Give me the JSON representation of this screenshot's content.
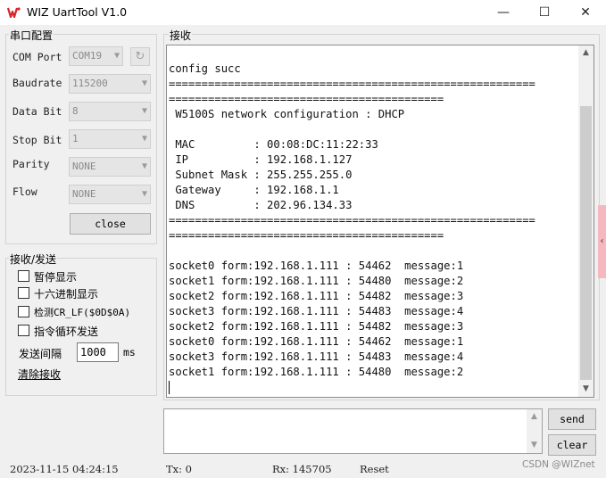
{
  "window": {
    "title": "WIZ UartTool V1.0",
    "controls": {
      "minimize": "—",
      "maximize": "☐",
      "close": "✕"
    }
  },
  "serial_config": {
    "group_label": "串口配置",
    "com_port": {
      "label": "COM Port",
      "value": "COM19"
    },
    "refresh_icon": "↻",
    "baudrate": {
      "label": "Baudrate",
      "value": "115200"
    },
    "data_bit": {
      "label": "Data Bit",
      "value": "8"
    },
    "stop_bit": {
      "label": "Stop Bit",
      "value": "1"
    },
    "parity": {
      "label": "Parity",
      "value": "NONE"
    },
    "flow": {
      "label": "Flow",
      "value": "NONE"
    },
    "close_button": "close"
  },
  "recv_send_options": {
    "group_label": "接收/发送",
    "pause_display": "暂停显示",
    "hex_display": "十六进制显示",
    "detect_crlf": "检测CR_LF($0D$0A)",
    "loop_send": "指令循环发送",
    "send_interval_label": "发送间隔",
    "send_interval_value": "1000",
    "send_interval_unit": "ms",
    "clear_receive_link": "清除接收"
  },
  "receive": {
    "group_label": "接收",
    "lines": [
      "config succ",
      "========================================================",
      "==========================================",
      " W5100S network configuration : DHCP",
      "",
      " MAC         : 00:08:DC:11:22:33",
      " IP          : 192.168.1.127",
      " Subnet Mask : 255.255.255.0",
      " Gateway     : 192.168.1.1",
      " DNS         : 202.96.134.33",
      "========================================================",
      "==========================================",
      "",
      "socket0 form:192.168.1.111 : 54462  message:1",
      "socket1 form:192.168.1.111 : 54480  message:2",
      "socket2 form:192.168.1.111 : 54482  message:3",
      "socket3 form:192.168.1.111 : 54483  message:4",
      "socket2 form:192.168.1.111 : 54482  message:3",
      "socket0 form:192.168.1.111 : 54462  message:1",
      "socket3 form:192.168.1.111 : 54483  message:4",
      "socket1 form:192.168.1.111 : 54480  message:2"
    ]
  },
  "send": {
    "input_value": "",
    "send_button": "send",
    "clear_button": "clear"
  },
  "status_bar": {
    "datetime": "2023-11-15 04:24:15",
    "tx": "Tx: 0",
    "rx": "Rx: 145705",
    "reset": "Reset"
  },
  "watermark": "CSDN @WIZnet",
  "side_tab_icon": "‹",
  "colors": {
    "logo_red": "#d9242b",
    "side_tab": "#f6b8c0",
    "disabled_text": "#8a8a8a"
  }
}
